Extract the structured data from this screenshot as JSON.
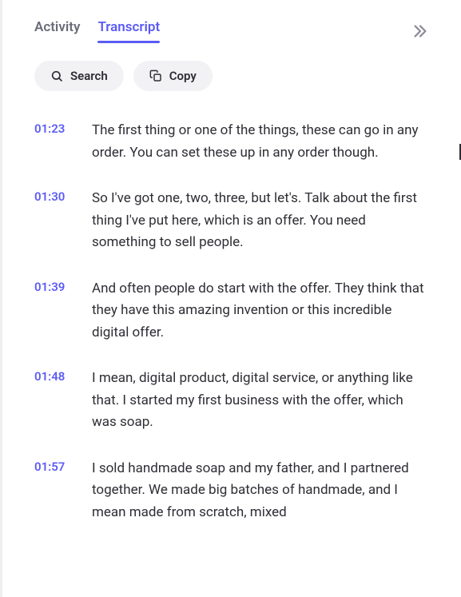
{
  "tabs": [
    {
      "label": "Activity",
      "active": false
    },
    {
      "label": "Transcript",
      "active": true
    }
  ],
  "toolbar": {
    "search_label": "Search",
    "copy_label": "Copy"
  },
  "transcript": [
    {
      "time": "01:23",
      "text": "The first thing or one of the things, these can go in any order. You can set these up in any order though."
    },
    {
      "time": "01:30",
      "text": "So I've got one, two, three, but let's. Talk about the first thing I've put here, which is an offer. You need something to sell people."
    },
    {
      "time": "01:39",
      "text": "And often people do start with the offer. They think that they have this amazing invention or this incredible digital offer."
    },
    {
      "time": "01:48",
      "text": "I mean, digital product, digital service, or anything like that. I started my first business with the offer, which was soap."
    },
    {
      "time": "01:57",
      "text": "I sold handmade soap and my father, and I partnered together. We made big batches of handmade, and I mean made from scratch, mixed"
    }
  ]
}
